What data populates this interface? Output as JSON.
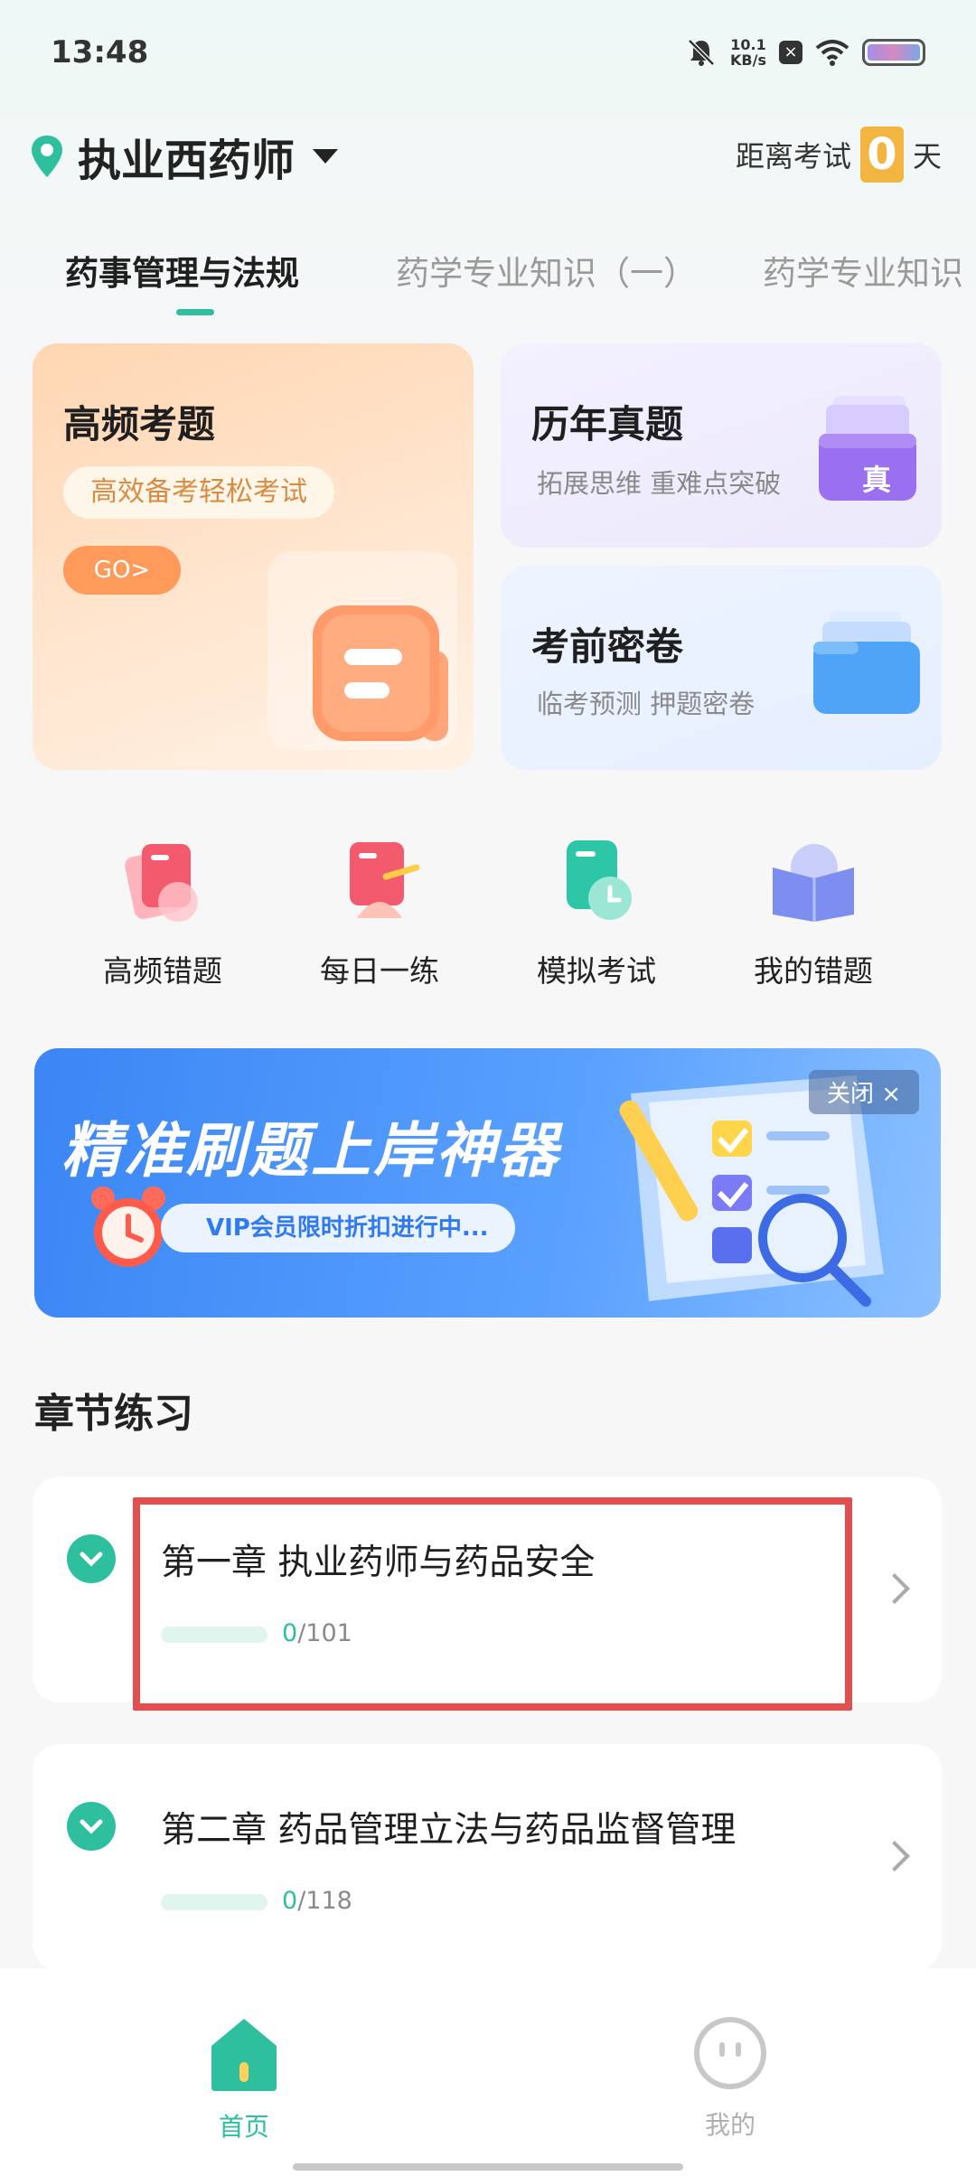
{
  "status_bar": {
    "time": "13:48",
    "net_speed_value": "10.1",
    "net_speed_unit": "KB/s"
  },
  "header": {
    "exam_name": "执业西药师",
    "countdown_prefix": "距离考试",
    "countdown_value": "0",
    "countdown_unit": "天"
  },
  "tabs": [
    {
      "label": "药事管理与法规",
      "active": true
    },
    {
      "label": "药学专业知识（一）",
      "active": false
    },
    {
      "label": "药学专业知识（二）",
      "active": false
    }
  ],
  "cards": {
    "high_freq": {
      "title": "高频考题",
      "pill": "高效备考轻松考试",
      "go": "GO>"
    },
    "past_papers": {
      "title": "历年真题",
      "subtitle": "拓展思维 重难点突破",
      "badge": "真"
    },
    "mock_secret": {
      "title": "考前密卷",
      "subtitle": "临考预测 押题密卷"
    }
  },
  "quick_actions": [
    {
      "label": "高频错题",
      "icon": "wrong-cards-icon"
    },
    {
      "label": "每日一练",
      "icon": "daily-practice-icon"
    },
    {
      "label": "模拟考试",
      "icon": "mock-exam-icon"
    },
    {
      "label": "我的错题",
      "icon": "my-mistakes-icon"
    }
  ],
  "banner": {
    "title": "精准刷题上岸神器",
    "pill": "VIP会员限时折扣进行中...",
    "close": "关闭 ×"
  },
  "chapters": {
    "section_title": "章节练习",
    "items": [
      {
        "title": "第一章 执业药师与药品安全",
        "done": "0",
        "total": "/101",
        "progress": 0
      },
      {
        "title": "第二章 药品管理立法与药品监督管理",
        "done": "0",
        "total": "/118",
        "progress": 0
      }
    ]
  },
  "bottom_nav": [
    {
      "label": "首页",
      "icon": "home-icon",
      "active": true
    },
    {
      "label": "我的",
      "icon": "profile-icon",
      "active": false
    }
  ],
  "colors": {
    "accent": "#2dbf9e",
    "highlight": "#e34e4e",
    "countdown": "#f2b542",
    "banner": "#3b86f5"
  }
}
